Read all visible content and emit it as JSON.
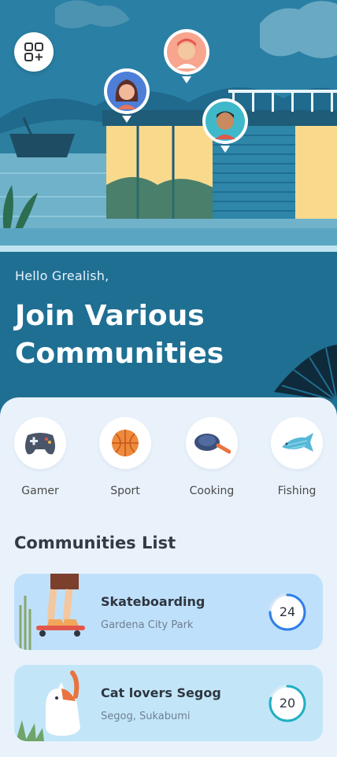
{
  "header": {
    "greeting": "Hello Grealish,",
    "headline": "Join Various Communities"
  },
  "categories": [
    {
      "label": "Gamer",
      "icon": "gamepad-icon"
    },
    {
      "label": "Sport",
      "icon": "basketball-icon"
    },
    {
      "label": "Cooking",
      "icon": "frying-pan-icon"
    },
    {
      "label": "Fishing",
      "icon": "fish-icon"
    }
  ],
  "communities": {
    "title": "Communities List",
    "items": [
      {
        "name": "Skateboarding",
        "location": "Gardena City Park",
        "count": "24",
        "progress": 0.75,
        "ring_color": "#2f7fe6"
      },
      {
        "name": "Cat lovers Segog",
        "location": "Segog, Sukabumi",
        "count": "20",
        "progress": 0.8,
        "ring_color": "#1fb0c2"
      }
    ]
  },
  "colors": {
    "primary": "#1f6f93",
    "sheet": "#e9f2fb",
    "card_skate": "#bfe0fb",
    "card_cat": "#c2e6f8"
  }
}
